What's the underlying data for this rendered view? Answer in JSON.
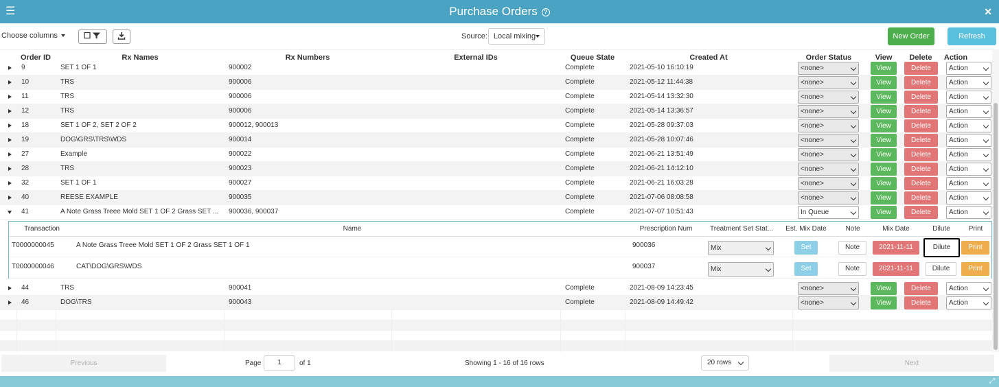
{
  "header": {
    "title": "Purchase Orders",
    "help_icon": "question-circle-icon",
    "menu_icon": "hamburger-icon",
    "close_icon": "close-icon"
  },
  "toolbar": {
    "choose_columns": "Choose columns",
    "source_label": "Source:",
    "source_value": "Local mixing",
    "new_order": "New Order",
    "refresh": "Refresh"
  },
  "columns": {
    "order_id": "Order ID",
    "rx_names": "Rx Names",
    "rx_numbers": "Rx Numbers",
    "external_ids": "External IDs",
    "queue_state": "Queue State",
    "created_at": "Created At",
    "order_status": "Order Status",
    "view": "View",
    "delete": "Delete",
    "action": "Action"
  },
  "row_buttons": {
    "view": "View",
    "delete": "Delete",
    "action": "Action"
  },
  "orders": [
    {
      "id": "9",
      "rx_names": "SET 1 OF 1",
      "rx_numbers": "900002",
      "queue_state": "Complete",
      "created_at": "2021-05-10 16:10:19",
      "status": "<none>"
    },
    {
      "id": "10",
      "rx_names": "TRS",
      "rx_numbers": "900006",
      "queue_state": "Complete",
      "created_at": "2021-05-12 11:44:38",
      "status": "<none>"
    },
    {
      "id": "11",
      "rx_names": "TRS",
      "rx_numbers": "900006",
      "queue_state": "Complete",
      "created_at": "2021-05-14 13:32:30",
      "status": "<none>"
    },
    {
      "id": "12",
      "rx_names": "TRS",
      "rx_numbers": "900006",
      "queue_state": "Complete",
      "created_at": "2021-05-14 13:36:57",
      "status": "<none>"
    },
    {
      "id": "18",
      "rx_names": "SET 1 OF 2, SET 2 OF 2",
      "rx_numbers": "900012, 900013",
      "queue_state": "Complete",
      "created_at": "2021-05-28 09:37:03",
      "status": "<none>"
    },
    {
      "id": "19",
      "rx_names": "DOG\\GRS\\TRS\\WDS",
      "rx_numbers": "900014",
      "queue_state": "Complete",
      "created_at": "2021-05-28 10:07:46",
      "status": "<none>"
    },
    {
      "id": "27",
      "rx_names": "Example",
      "rx_numbers": "900022",
      "queue_state": "Complete",
      "created_at": "2021-06-21 13:51:49",
      "status": "<none>"
    },
    {
      "id": "28",
      "rx_names": "TRS",
      "rx_numbers": "900023",
      "queue_state": "Complete",
      "created_at": "2021-06-21 14:12:10",
      "status": "<none>"
    },
    {
      "id": "32",
      "rx_names": "SET 1 OF 1",
      "rx_numbers": "900027",
      "queue_state": "Complete",
      "created_at": "2021-06-21 16:03:28",
      "status": "<none>"
    },
    {
      "id": "40",
      "rx_names": "REESE EXAMPLE",
      "rx_numbers": "900035",
      "queue_state": "Complete",
      "created_at": "2021-07-06 08:08:58",
      "status": "<none>"
    },
    {
      "id": "41",
      "rx_names": "A Note Grass Treee Mold SET 1 OF 2 Grass SET ...",
      "rx_numbers": "900036, 900037",
      "queue_state": "Complete",
      "created_at": "2021-07-07 10:51:43",
      "status": "In Queue"
    },
    {
      "id": "44",
      "rx_names": "TRS",
      "rx_numbers": "900041",
      "queue_state": "Complete",
      "created_at": "2021-08-09 14:23:45",
      "status": "<none>"
    },
    {
      "id": "46",
      "rx_names": "DOG\\TRS",
      "rx_numbers": "900043",
      "queue_state": "Complete",
      "created_at": "2021-08-09 14:49:42",
      "status": "<none>"
    }
  ],
  "detail": {
    "columns": {
      "transaction": "Transaction",
      "name": "Name",
      "prescription_num": "Prescription Num",
      "treatment_set_status": "Treatment Set Stat...",
      "est_mix_date": "Est. Mix Date",
      "note": "Note",
      "mix_date": "Mix Date",
      "dilute": "Dilute",
      "print": "Print"
    },
    "rows": [
      {
        "transaction": "T0000000045",
        "name": "A Note Grass Treee Mold SET 1 OF 2 Grass SET 1 OF 1",
        "prescription_num": "900036",
        "status": "Mix",
        "set": "Set",
        "note": "Note",
        "mix_date": "2021-11-11",
        "dilute": "Dilute",
        "print": "Print"
      },
      {
        "transaction": "T0000000046",
        "name": "CAT\\DOG\\GRS\\WDS",
        "prescription_num": "900037",
        "status": "Mix",
        "set": "Set",
        "note": "Note",
        "mix_date": "2021-11-11",
        "dilute": "Dilute",
        "print": "Print"
      }
    ]
  },
  "pager": {
    "previous": "Previous",
    "next": "Next",
    "page_label": "Page",
    "page_value": "1",
    "of_label": "of 1",
    "showing": "Showing 1 - 16 of 16 rows",
    "rows_per_page": "20 rows"
  },
  "colors": {
    "header": "#4ba3c3",
    "view": "#5cb85c",
    "delete": "#e27575",
    "print": "#f0ad4e",
    "refresh": "#5bc0de",
    "new_order": "#4cae4c"
  }
}
